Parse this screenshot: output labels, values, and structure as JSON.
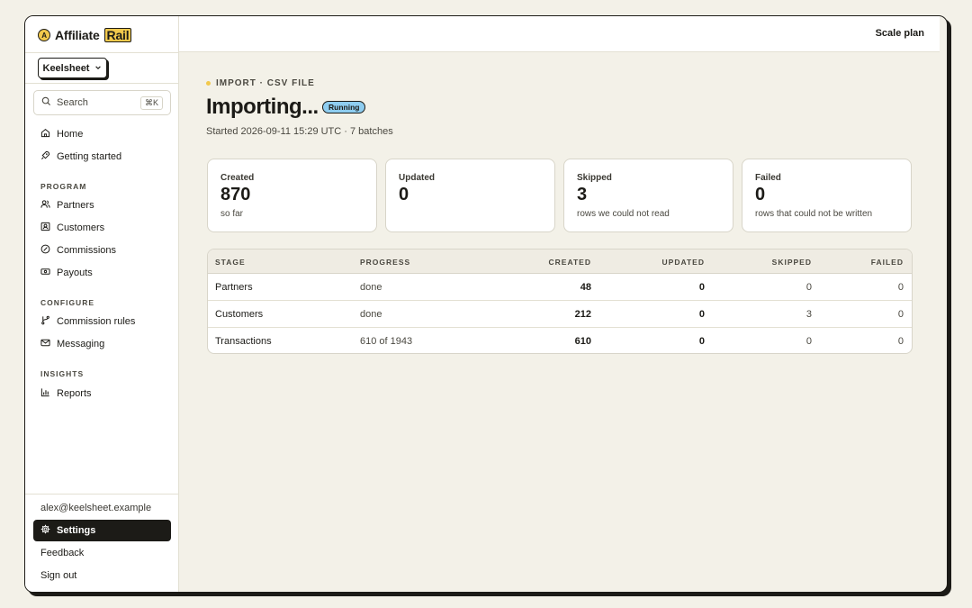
{
  "brand": {
    "name_prefix": "Affiliate",
    "name_highlight": "Rail",
    "mark": "A"
  },
  "workspace": {
    "name": "Keelsheet"
  },
  "search": {
    "placeholder": "Search",
    "shortcut": "⌘K"
  },
  "nav": {
    "top": [
      {
        "label": "Home",
        "icon": "home-icon"
      },
      {
        "label": "Getting started",
        "icon": "rocket-icon"
      }
    ],
    "program_label": "PROGRAM",
    "program": [
      {
        "label": "Partners",
        "icon": "users-icon"
      },
      {
        "label": "Customers",
        "icon": "contact-icon"
      },
      {
        "label": "Commissions",
        "icon": "percent-icon"
      },
      {
        "label": "Payouts",
        "icon": "banknote-icon"
      }
    ],
    "configure_label": "CONFIGURE",
    "configure": [
      {
        "label": "Commission rules",
        "icon": "git-branch-icon"
      },
      {
        "label": "Messaging",
        "icon": "mail-icon"
      }
    ],
    "insights_label": "INSIGHTS",
    "insights": [
      {
        "label": "Reports",
        "icon": "bar-chart-icon"
      }
    ]
  },
  "account": {
    "email": "alex@keelsheet.example",
    "settings": "Settings",
    "feedback": "Feedback",
    "sign_out": "Sign out"
  },
  "topbar": {
    "scale_plan": "Scale plan"
  },
  "page": {
    "eyebrow": "IMPORT · CSV FILE",
    "title": "Importing...",
    "status": "Running",
    "meta": "Started 2026-09-11 15:29 UTC · 7 batches"
  },
  "stats": [
    {
      "label": "Created",
      "value": "870",
      "sub": "so far"
    },
    {
      "label": "Updated",
      "value": "0",
      "sub": ""
    },
    {
      "label": "Skipped",
      "value": "3",
      "sub": "rows we could not read"
    },
    {
      "label": "Failed",
      "value": "0",
      "sub": "rows that could not be written"
    }
  ],
  "table": {
    "headers": [
      "STAGE",
      "PROGRESS",
      "CREATED",
      "UPDATED",
      "SKIPPED",
      "FAILED"
    ],
    "rows": [
      [
        "Partners",
        "done",
        "48",
        "0",
        "0",
        "0"
      ],
      [
        "Customers",
        "done",
        "212",
        "0",
        "3",
        "0"
      ],
      [
        "Transactions",
        "610 of 1943",
        "610",
        "0",
        "0",
        "0"
      ]
    ]
  },
  "colors": {
    "accent": "#f2c94c",
    "running_badge": "#8ecdf0",
    "ink": "#1c1b17",
    "background": "#f3f1e8"
  }
}
